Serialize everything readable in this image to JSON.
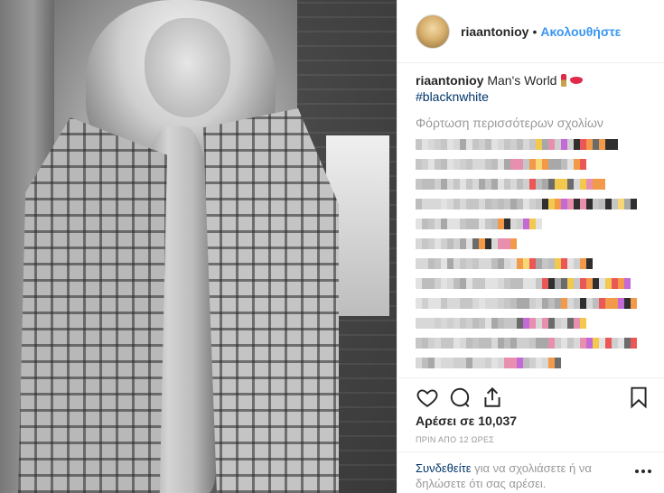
{
  "header": {
    "username": "riaantonioy",
    "separator": "•",
    "follow_label": "Ακολουθήστε"
  },
  "caption": {
    "username": "riaantonioy",
    "text": "Man's World",
    "emoji_icons": [
      "lipstick-icon",
      "kiss-lips-icon"
    ],
    "hashtag": "#blacknwhite"
  },
  "comments": {
    "load_more_label": "Φόρτωση περισσότερων σχολίων",
    "pixelated_note": "obscured comments"
  },
  "colors": {
    "accent": "#3897f0",
    "link": "#003569",
    "muted": "#999999",
    "text": "#262626"
  },
  "actions": {
    "icons": [
      "heart-icon",
      "comment-icon",
      "share-icon",
      "bookmark-icon"
    ]
  },
  "likes": {
    "label": "Αρέσει σε 10,037"
  },
  "timestamp": "ΠΡΙΝ ΑΠΟ 12 ΩΡΕΣ",
  "login_prompt": {
    "link": "Συνδεθείτε",
    "text": " για να σχολιάσετε ή να δηλώσετε ότι σας αρέσει."
  }
}
